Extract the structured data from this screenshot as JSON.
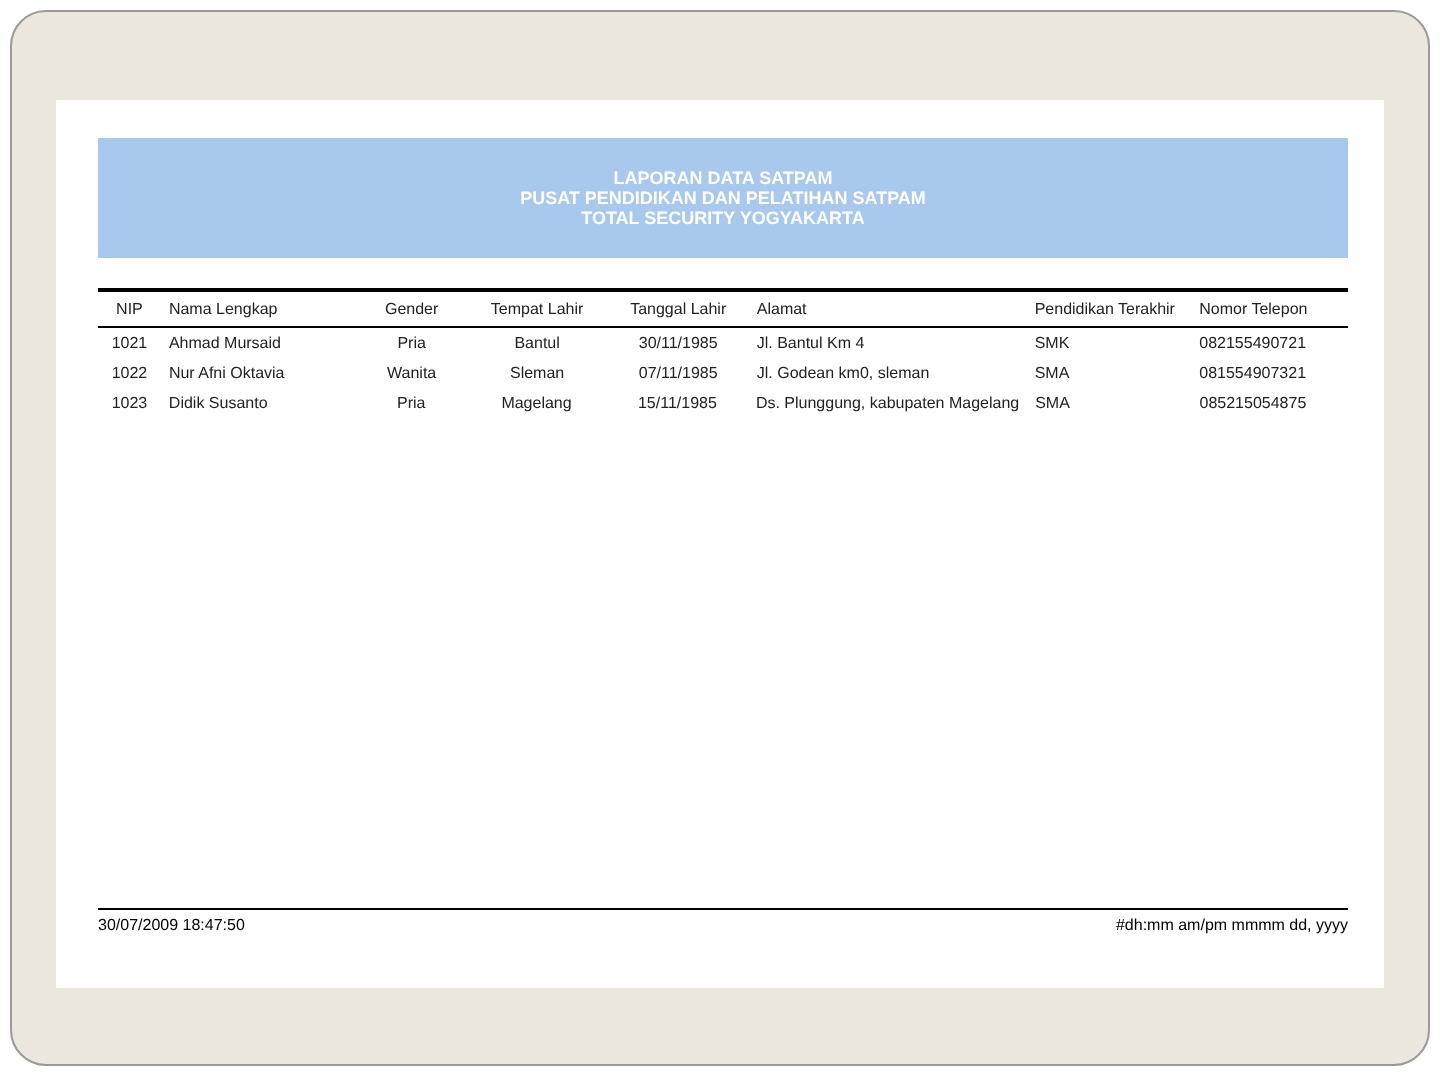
{
  "report": {
    "title_lines": [
      "LAPORAN DATA SATPAM",
      "PUSAT PENDIDIKAN DAN PELATIHAN SATPAM",
      "TOTAL SECURITY YOGYAKARTA"
    ],
    "columns": [
      "NIP",
      "Nama Lengkap",
      "Gender",
      "Tempat Lahir",
      "Tanggal Lahir",
      "Alamat",
      "Pendidikan Terakhir",
      "Nomor Telepon"
    ],
    "rows": [
      [
        "1021",
        "Ahmad Mursaid",
        "Pria",
        "Bantul",
        "30/11/1985",
        "Jl. Bantul Km 4",
        "SMK",
        "082155490721"
      ],
      [
        "1022",
        "Nur Afni Oktavia",
        "Wanita",
        "Sleman",
        "07/11/1985",
        "Jl. Godean km0, sleman",
        "SMA",
        "081554907321"
      ],
      [
        "1023",
        "Didik Susanto",
        "Pria",
        "Magelang",
        "15/11/1985",
        "Ds. Plunggung, kabupaten Magelang",
        "SMA",
        "085215054875"
      ]
    ],
    "footer_left": "30/07/2009 18:47:50",
    "footer_right": "#dh:mm am/pm mmmm dd, yyyy"
  }
}
